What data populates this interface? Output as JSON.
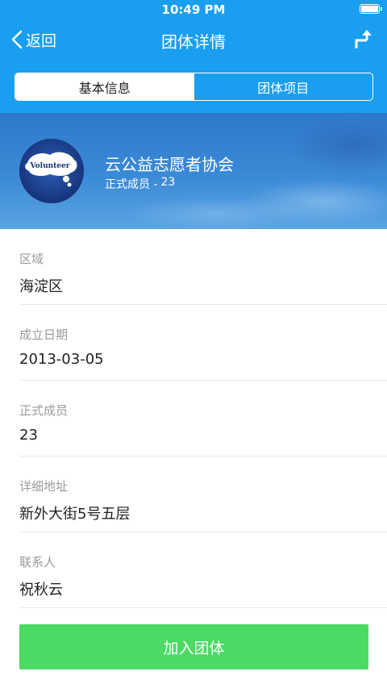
{
  "status_bar": {
    "time": "10:49 PM"
  },
  "nav": {
    "back_label": "返回",
    "title": "团体详情"
  },
  "tabs": [
    {
      "label": "基本信息",
      "active": true
    },
    {
      "label": "团体项目",
      "active": false
    }
  ],
  "team": {
    "name": "云公益志愿者协会",
    "member_label": "正式成员 -",
    "member_count": "23",
    "avatar_text": "Volunteer"
  },
  "fields": [
    {
      "label": "区域",
      "value": "海淀区"
    },
    {
      "label": "成立日期",
      "value": "2013-03-05"
    },
    {
      "label": "正式成员",
      "value": "23"
    },
    {
      "label": "详细地址",
      "value": "新外大街5号五层"
    },
    {
      "label": "联系人",
      "value": "祝秋云"
    }
  ],
  "join_button": "加入团体",
  "colors": {
    "header": "#1a9ef0",
    "join_button": "#4cd964",
    "label_gray": "#9a9a9a"
  }
}
